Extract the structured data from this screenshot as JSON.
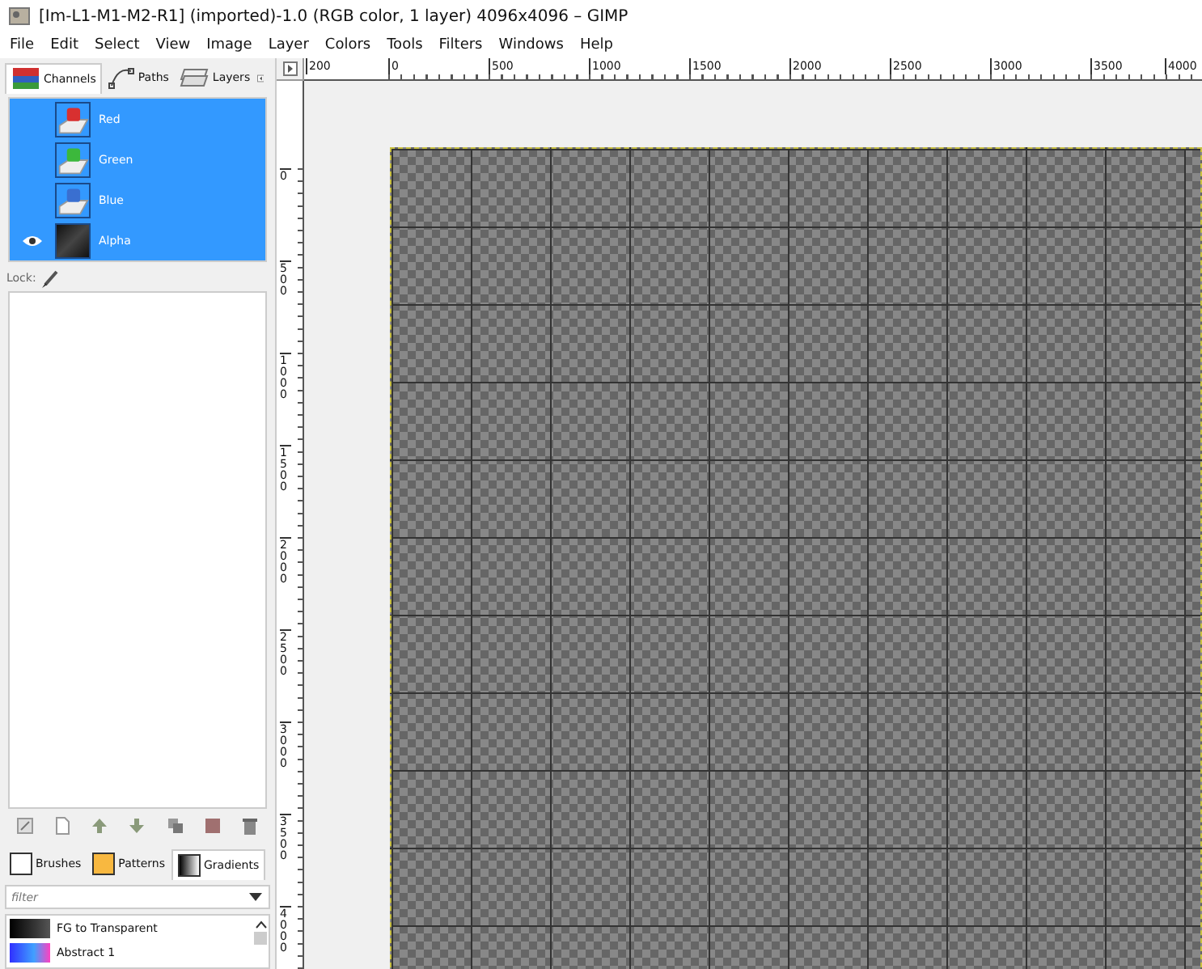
{
  "window": {
    "title": "[Im-L1-M1-M2-R1] (imported)-1.0 (RGB color, 1 layer) 4096x4096 – GIMP"
  },
  "menu": [
    "File",
    "Edit",
    "Select",
    "View",
    "Image",
    "Layer",
    "Colors",
    "Tools",
    "Filters",
    "Windows",
    "Help"
  ],
  "dock_tabs": [
    {
      "label": "Channels",
      "selected": true,
      "kind": "channels"
    },
    {
      "label": "Paths",
      "selected": false,
      "kind": "paths"
    },
    {
      "label": "Layers",
      "selected": false,
      "kind": "layers"
    }
  ],
  "channels": [
    {
      "name": "Red",
      "visible": false,
      "selected": true,
      "kind": "red"
    },
    {
      "name": "Green",
      "visible": false,
      "selected": true,
      "kind": "green"
    },
    {
      "name": "Blue",
      "visible": false,
      "selected": true,
      "kind": "blue"
    },
    {
      "name": "Alpha",
      "visible": true,
      "selected": true,
      "kind": "alpha"
    }
  ],
  "lock_label": "Lock:",
  "resource_tabs": [
    {
      "label": "Brushes",
      "selected": false,
      "kind": "brushes"
    },
    {
      "label": "Patterns",
      "selected": false,
      "kind": "patterns"
    },
    {
      "label": "Gradients",
      "selected": true,
      "kind": "gradients"
    }
  ],
  "filter": {
    "placeholder": "filter"
  },
  "gradients": [
    {
      "name": "FG to Transparent",
      "kind": "fg"
    },
    {
      "name": "Abstract 1",
      "kind": "abstract"
    }
  ],
  "h_ruler": [
    "200",
    "0",
    "500",
    "1000",
    "1500",
    "2000",
    "2500",
    "3000",
    "3500",
    "4000"
  ],
  "v_ruler": [
    "0",
    "500",
    "1000",
    "1500",
    "2000",
    "2500",
    "3000",
    "3500",
    "4000"
  ]
}
